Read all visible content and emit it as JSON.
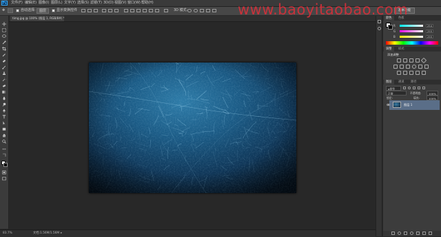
{
  "app": {
    "logo": "Ps",
    "watermark": "www.baoyitaobao.com"
  },
  "menubar": {
    "items": [
      "文件(F)",
      "编辑(E)",
      "图像(I)",
      "图层(L)",
      "文字(Y)",
      "选择(S)",
      "滤镜(T)",
      "3D(D)",
      "视图(V)",
      "窗口(W)",
      "帮助(H)"
    ]
  },
  "options": {
    "auto_select_label": "自动选择:",
    "auto_select_value": "图层",
    "transform_label": "显示变换控件",
    "workspace": "基本功能"
  },
  "document": {
    "tab_title": "timg.jpg @ 100% (图层 1, RGB/8#) *"
  },
  "status": {
    "zoom": "83.7%",
    "doc_size": "文档:1.56M/1.56M"
  },
  "color_panel": {
    "tabs": [
      "颜色",
      "色板"
    ],
    "channels": [
      {
        "label": "R",
        "value": "254",
        "color": "#d84848"
      },
      {
        "label": "G",
        "value": "255",
        "color": "#48c848"
      },
      {
        "label": "B",
        "value": "255",
        "color": "#4878e0"
      }
    ]
  },
  "adjustments_panel": {
    "tabs": [
      "调整",
      "样式"
    ],
    "add_label": "添加调整"
  },
  "layers_panel": {
    "tabs": [
      "图层",
      "通道",
      "路径"
    ],
    "kind_label": "ρ类型",
    "blend_mode": "正常",
    "opacity_label": "不透明度:",
    "opacity_value": "100%",
    "lock_label": "锁定:",
    "fill_label": "填充:",
    "fill_value": "100%",
    "layers": [
      {
        "name": "图层 1"
      }
    ]
  },
  "colors": {
    "accent": "#31a8ff",
    "watermark": "#d3313a",
    "selected_layer": "#5a6e88"
  }
}
